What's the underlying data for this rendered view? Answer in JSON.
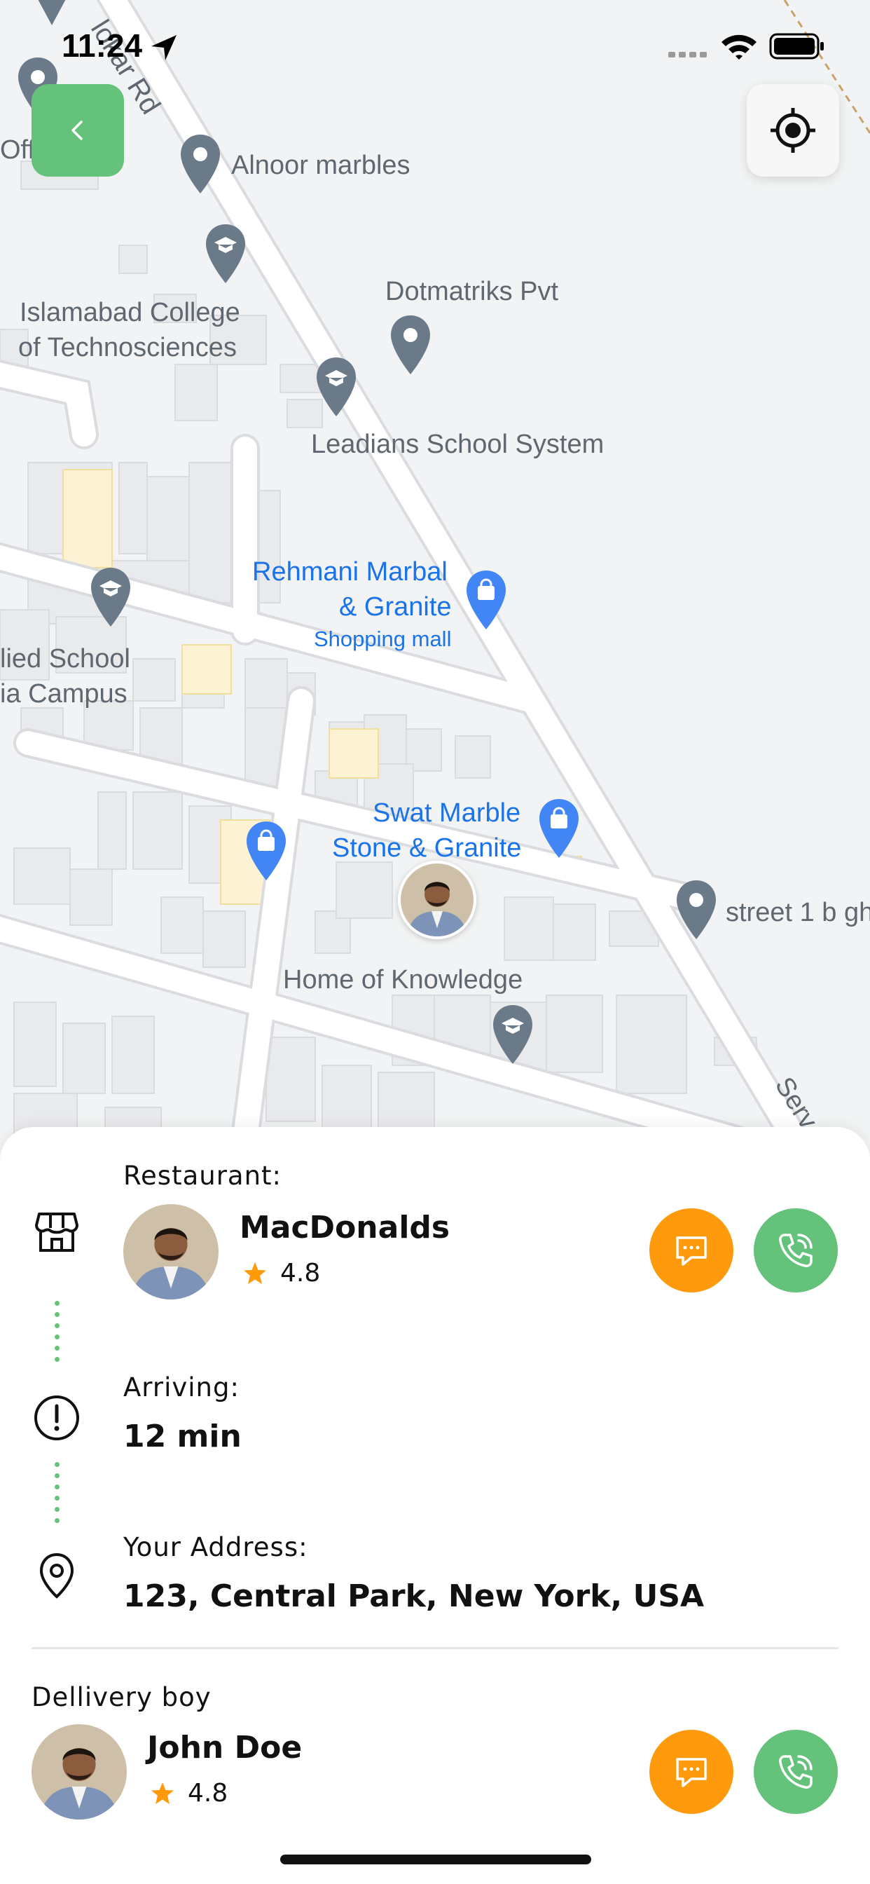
{
  "status_bar": {
    "time": "11:24"
  },
  "map": {
    "labels": {
      "road_top": "lokar Rd",
      "offi": "Offi",
      "alnoor": "Alnoor marbles",
      "dotmatriks": "Dotmatriks Pvt",
      "islamabad_1": "Islamabad College",
      "islamabad_2": "of Technosciences",
      "leadians": "Leadians School System",
      "rehmani_1": "Rehmani Marbal",
      "rehmani_2": "& Granite",
      "rehmani_3": "Shopping mall",
      "allied_1": "lied School",
      "allied_2": "ia Campus",
      "swat_1": "Swat Marble",
      "swat_2": "Stone & Granite",
      "street": "street 1 b gh",
      "home_knowledge": "Home of Knowledge",
      "road_bottom": "Serv"
    }
  },
  "restaurant": {
    "label": "Restaurant:",
    "name": "MacDonalds",
    "rating": "4.8"
  },
  "arriving": {
    "label": "Arriving:",
    "value": "12 min"
  },
  "address": {
    "label": "Your Address:",
    "value": "123, Central Park, New York, USA"
  },
  "delivery": {
    "label": "Dellivery boy",
    "name": "John Doe",
    "rating": "4.8"
  },
  "colors": {
    "accent_green": "#64c27a",
    "accent_orange": "#ff9a0d",
    "star": "#ff9a0d",
    "map_label_blue": "#1a73e8"
  },
  "icons": {
    "back": "chevron-left-icon",
    "locate": "crosshair-icon",
    "store": "store-icon",
    "alert": "alert-circle-icon",
    "location": "location-pin-icon",
    "chat": "chat-icon",
    "phone": "phone-icon",
    "star": "star-icon"
  }
}
